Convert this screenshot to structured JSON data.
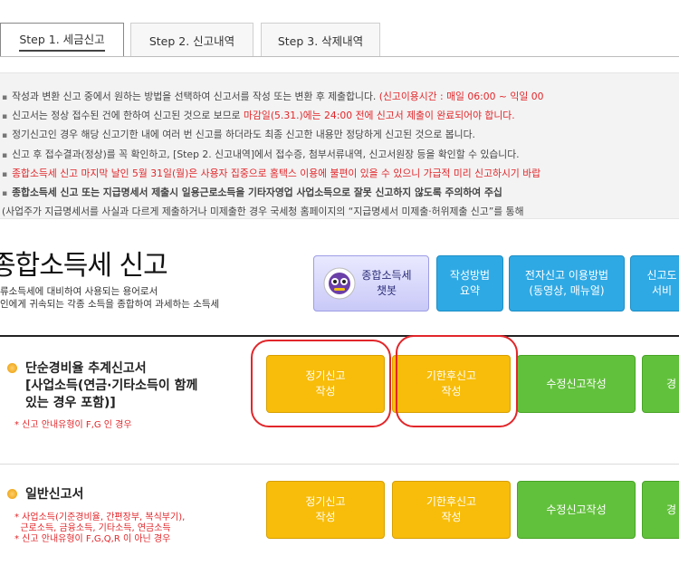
{
  "tabs": [
    {
      "label": "Step 1. 세금신고",
      "active": true
    },
    {
      "label": "Step 2. 신고내역",
      "active": false
    },
    {
      "label": "Step 3. 삭제내역",
      "active": false
    }
  ],
  "notice": {
    "line1": "작성과 변환 신고 중에서 원하는 방법을 선택하여 신고서를 작성 또는 변환 후 제출합니다.",
    "line1_red": "(신고이용시간 : 매일 06:00 ~ 익일 00",
    "line2": "신고서는 정상 접수된 건에 한하여 신고된 것으로 보므로",
    "line2_red": "마감일(5.31.)에는 24:00 전에 신고서 제출이 완료되어야 합니다.",
    "line3": "정기신고인 경우 해당 신고기한 내에 여러 번 신고를 하더라도 최종 신고한 내용만 정당하게 신고된 것으로 봅니다.",
    "line4": "신고 후 접수결과(정상)를 꼭 확인하고, [Step 2. 신고내역]에서 접수증, 첨부서류내역, 신고서원장 등을 확인할 수 있습니다.",
    "line5_red": "종합소득세 신고 마지막 날인 5월 31일(월)은 사용자 집중으로 홈택스 이용에 불편이 있을 수 있으니 가급적 미리 신고하시기 바랍",
    "line6_bold": "종합소득세 신고 또는 지급명세서 제출시 일용근로소득을 기타자영업 사업소득으로 잘못 신고하지 않도록 주의하여 주십",
    "line7": "(사업주가 지급명세서를 사실과 다르게 제출하거나 미제출한 경우 국세청 홈페이지의 “지급명세서 미제출·허위제출 신고”를 통해"
  },
  "heading": {
    "title": "종합소득세 신고",
    "desc1": "류소득세에 대비하여 사용되는 용어로서",
    "desc2": "인에게 귀속되는 각종 소득을 종합하여 과세하는 소득세"
  },
  "top_buttons": {
    "chatbot": "종합소득세\n챗봇",
    "guide": "작성방법\n요약",
    "epay": "전자신고 이용방법\n(동영상, 매뉴얼)",
    "svc": "신고도\n서비"
  },
  "section1": {
    "title": "단순경비율 추계신고서\n[사업소득(연금·기타소득이 함께\n있는 경우 포함)]",
    "note": "* 신고 안내유형이 F,G 인 경우",
    "btn_regular": "정기신고\n작성",
    "btn_late": "기한후신고\n작성",
    "btn_amend": "수정신고작성",
    "btn_extra": "경"
  },
  "section2": {
    "title": "일반신고서",
    "note": "* 사업소득(기준경비율, 간편장부, 복식부기),\n  근로소득, 금융소득, 기타소득, 연금소득\n* 신고 안내유형이 F,G,Q,R 이 아닌 경우",
    "btn_regular": "정기신고\n작성",
    "btn_late": "기한후신고\n작성",
    "btn_amend": "수정신고작성",
    "btn_extra": "경"
  },
  "colors": {
    "accent_red": "#e2262a",
    "yellow": "#f8bd0a",
    "green": "#62c13c",
    "blue": "#2fa9e4"
  }
}
